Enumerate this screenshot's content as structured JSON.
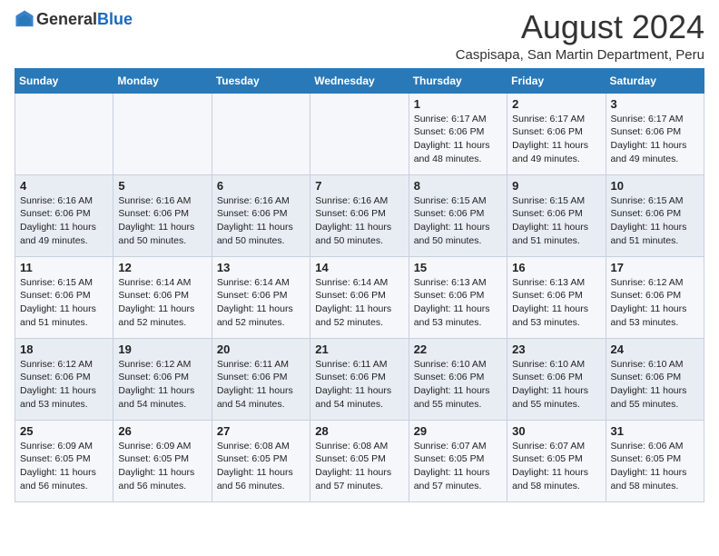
{
  "logo": {
    "general": "General",
    "blue": "Blue"
  },
  "title": "August 2024",
  "location": "Caspisapa, San Martin Department, Peru",
  "weekdays": [
    "Sunday",
    "Monday",
    "Tuesday",
    "Wednesday",
    "Thursday",
    "Friday",
    "Saturday"
  ],
  "weeks": [
    [
      {
        "day": "",
        "detail": ""
      },
      {
        "day": "",
        "detail": ""
      },
      {
        "day": "",
        "detail": ""
      },
      {
        "day": "",
        "detail": ""
      },
      {
        "day": "1",
        "detail": "Sunrise: 6:17 AM\nSunset: 6:06 PM\nDaylight: 11 hours\nand 48 minutes."
      },
      {
        "day": "2",
        "detail": "Sunrise: 6:17 AM\nSunset: 6:06 PM\nDaylight: 11 hours\nand 49 minutes."
      },
      {
        "day": "3",
        "detail": "Sunrise: 6:17 AM\nSunset: 6:06 PM\nDaylight: 11 hours\nand 49 minutes."
      }
    ],
    [
      {
        "day": "4",
        "detail": "Sunrise: 6:16 AM\nSunset: 6:06 PM\nDaylight: 11 hours\nand 49 minutes."
      },
      {
        "day": "5",
        "detail": "Sunrise: 6:16 AM\nSunset: 6:06 PM\nDaylight: 11 hours\nand 50 minutes."
      },
      {
        "day": "6",
        "detail": "Sunrise: 6:16 AM\nSunset: 6:06 PM\nDaylight: 11 hours\nand 50 minutes."
      },
      {
        "day": "7",
        "detail": "Sunrise: 6:16 AM\nSunset: 6:06 PM\nDaylight: 11 hours\nand 50 minutes."
      },
      {
        "day": "8",
        "detail": "Sunrise: 6:15 AM\nSunset: 6:06 PM\nDaylight: 11 hours\nand 50 minutes."
      },
      {
        "day": "9",
        "detail": "Sunrise: 6:15 AM\nSunset: 6:06 PM\nDaylight: 11 hours\nand 51 minutes."
      },
      {
        "day": "10",
        "detail": "Sunrise: 6:15 AM\nSunset: 6:06 PM\nDaylight: 11 hours\nand 51 minutes."
      }
    ],
    [
      {
        "day": "11",
        "detail": "Sunrise: 6:15 AM\nSunset: 6:06 PM\nDaylight: 11 hours\nand 51 minutes."
      },
      {
        "day": "12",
        "detail": "Sunrise: 6:14 AM\nSunset: 6:06 PM\nDaylight: 11 hours\nand 52 minutes."
      },
      {
        "day": "13",
        "detail": "Sunrise: 6:14 AM\nSunset: 6:06 PM\nDaylight: 11 hours\nand 52 minutes."
      },
      {
        "day": "14",
        "detail": "Sunrise: 6:14 AM\nSunset: 6:06 PM\nDaylight: 11 hours\nand 52 minutes."
      },
      {
        "day": "15",
        "detail": "Sunrise: 6:13 AM\nSunset: 6:06 PM\nDaylight: 11 hours\nand 53 minutes."
      },
      {
        "day": "16",
        "detail": "Sunrise: 6:13 AM\nSunset: 6:06 PM\nDaylight: 11 hours\nand 53 minutes."
      },
      {
        "day": "17",
        "detail": "Sunrise: 6:12 AM\nSunset: 6:06 PM\nDaylight: 11 hours\nand 53 minutes."
      }
    ],
    [
      {
        "day": "18",
        "detail": "Sunrise: 6:12 AM\nSunset: 6:06 PM\nDaylight: 11 hours\nand 53 minutes."
      },
      {
        "day": "19",
        "detail": "Sunrise: 6:12 AM\nSunset: 6:06 PM\nDaylight: 11 hours\nand 54 minutes."
      },
      {
        "day": "20",
        "detail": "Sunrise: 6:11 AM\nSunset: 6:06 PM\nDaylight: 11 hours\nand 54 minutes."
      },
      {
        "day": "21",
        "detail": "Sunrise: 6:11 AM\nSunset: 6:06 PM\nDaylight: 11 hours\nand 54 minutes."
      },
      {
        "day": "22",
        "detail": "Sunrise: 6:10 AM\nSunset: 6:06 PM\nDaylight: 11 hours\nand 55 minutes."
      },
      {
        "day": "23",
        "detail": "Sunrise: 6:10 AM\nSunset: 6:06 PM\nDaylight: 11 hours\nand 55 minutes."
      },
      {
        "day": "24",
        "detail": "Sunrise: 6:10 AM\nSunset: 6:06 PM\nDaylight: 11 hours\nand 55 minutes."
      }
    ],
    [
      {
        "day": "25",
        "detail": "Sunrise: 6:09 AM\nSunset: 6:05 PM\nDaylight: 11 hours\nand 56 minutes."
      },
      {
        "day": "26",
        "detail": "Sunrise: 6:09 AM\nSunset: 6:05 PM\nDaylight: 11 hours\nand 56 minutes."
      },
      {
        "day": "27",
        "detail": "Sunrise: 6:08 AM\nSunset: 6:05 PM\nDaylight: 11 hours\nand 56 minutes."
      },
      {
        "day": "28",
        "detail": "Sunrise: 6:08 AM\nSunset: 6:05 PM\nDaylight: 11 hours\nand 57 minutes."
      },
      {
        "day": "29",
        "detail": "Sunrise: 6:07 AM\nSunset: 6:05 PM\nDaylight: 11 hours\nand 57 minutes."
      },
      {
        "day": "30",
        "detail": "Sunrise: 6:07 AM\nSunset: 6:05 PM\nDaylight: 11 hours\nand 58 minutes."
      },
      {
        "day": "31",
        "detail": "Sunrise: 6:06 AM\nSunset: 6:05 PM\nDaylight: 11 hours\nand 58 minutes."
      }
    ]
  ]
}
